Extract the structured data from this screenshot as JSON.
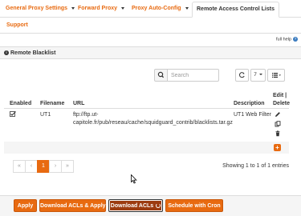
{
  "tabs": {
    "general_proxy": "General Proxy Settings",
    "forward_proxy": "Forward Proxy",
    "proxy_auto_config": "Proxy Auto-Config",
    "remote_acl": "Remote Access Control Lists",
    "support": "Support"
  },
  "help": {
    "label": "full help",
    "icon": "question-circle-icon"
  },
  "panel": {
    "title": "Remote Blacklist",
    "icon": "info-icon"
  },
  "search": {
    "placeholder": "Search"
  },
  "toolbar": {
    "page_size": "7",
    "refresh_icon": "refresh-icon",
    "columns_icon": "list-icon"
  },
  "table": {
    "headers": {
      "enabled": "Enabled",
      "filename": "Filename",
      "url": "URL",
      "description": "Description",
      "edit_delete_1": "Edit |",
      "edit_delete_2": "Delete"
    },
    "rows": [
      {
        "enabled": true,
        "filename": "UT1",
        "url_line1": "ftp://ftp.ut-",
        "url_line2": "capitole.fr/pub/reseau/cache/squidguard_contrib/blacklists.tar.gz",
        "description": "UT1 Web Filter"
      }
    ]
  },
  "pager": {
    "first": "«",
    "prev": "‹",
    "current": "1",
    "next": "›",
    "last": "»"
  },
  "showing": "Showing 1 to 1 of 1 entries",
  "buttons": {
    "apply": "Apply",
    "download_apply": "Download ACLs & Apply",
    "download": "Download ACLs",
    "schedule": "Schedule with Cron"
  },
  "colors": {
    "accent": "#e86a10",
    "dark_button": "#9c3b10"
  }
}
